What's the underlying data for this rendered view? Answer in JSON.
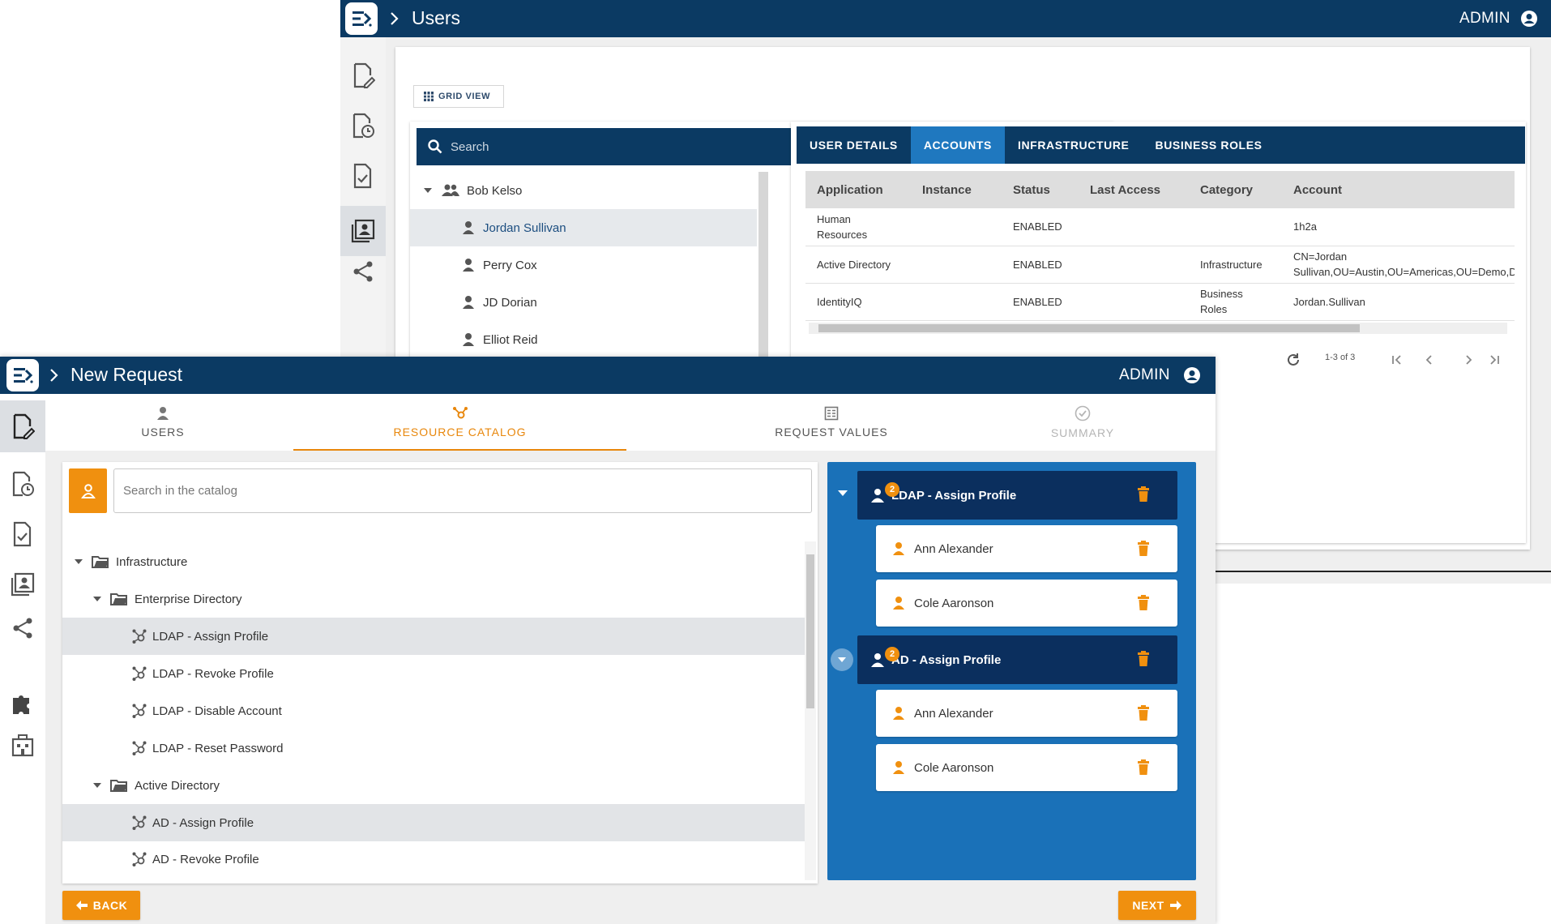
{
  "users_window": {
    "title": "Users",
    "admin_label": "ADMIN",
    "grid_view_label": "GRID VIEW",
    "search_placeholder": "Search",
    "tree": {
      "group": "Bob Kelso",
      "users": [
        "Jordan Sullivan",
        "Perry Cox",
        "JD Dorian",
        "Elliot Reid"
      ],
      "selected": "Jordan Sullivan"
    },
    "tabs": [
      "USER DETAILS",
      "ACCOUNTS",
      "INFRASTRUCTURE",
      "BUSINESS ROLES"
    ],
    "active_tab": "ACCOUNTS",
    "table": {
      "columns": [
        "Application",
        "Instance",
        "Status",
        "Last Access",
        "Category",
        "Account"
      ],
      "rows": [
        [
          "Human Resources",
          "",
          "ENABLED",
          "",
          "",
          "1h2a"
        ],
        [
          "Active Directory",
          "",
          "ENABLED",
          "",
          "Infrastructure",
          "CN=Jordan Sullivan,OU=Austin,OU=Americas,OU=Demo,D"
        ],
        [
          "IdentityIQ",
          "",
          "ENABLED",
          "",
          "Business Roles",
          "Jordan.Sullivan"
        ]
      ]
    },
    "pagination": "1-3 of 3"
  },
  "request_window": {
    "title": "New Request",
    "admin_label": "ADMIN",
    "steps": [
      {
        "label": "USERS",
        "state": "done"
      },
      {
        "label": "RESOURCE CATALOG",
        "state": "active"
      },
      {
        "label": "REQUEST VALUES",
        "state": "pending"
      },
      {
        "label": "SUMMARY",
        "state": "disabled"
      }
    ],
    "catalog_search_placeholder": "Search in the catalog",
    "catalog_tree": {
      "root": "Infrastructure",
      "folders": [
        {
          "name": "Enterprise Directory",
          "items": [
            "LDAP - Assign Profile",
            "LDAP - Revoke Profile",
            "LDAP - Disable Account",
            "LDAP - Reset Password"
          ]
        },
        {
          "name": "Active Directory",
          "items": [
            "AD - Assign Profile",
            "AD - Revoke Profile"
          ]
        }
      ],
      "selected": [
        "LDAP - Assign Profile",
        "AD - Assign Profile"
      ]
    },
    "cart": [
      {
        "title": "LDAP - Assign Profile",
        "count": "2",
        "members": [
          "Ann Alexander",
          "Cole Aaronson"
        ]
      },
      {
        "title": "AD - Assign Profile",
        "count": "2",
        "members": [
          "Ann Alexander",
          "Cole Aaronson"
        ]
      }
    ],
    "back_label": "BACK",
    "next_label": "NEXT"
  },
  "colors": {
    "navy": "#0b3a63",
    "accent_blue": "#1f78bf",
    "orange": "#f0900f",
    "cart_blue": "#1a71b8",
    "group_navy": "#0b2f5e"
  }
}
